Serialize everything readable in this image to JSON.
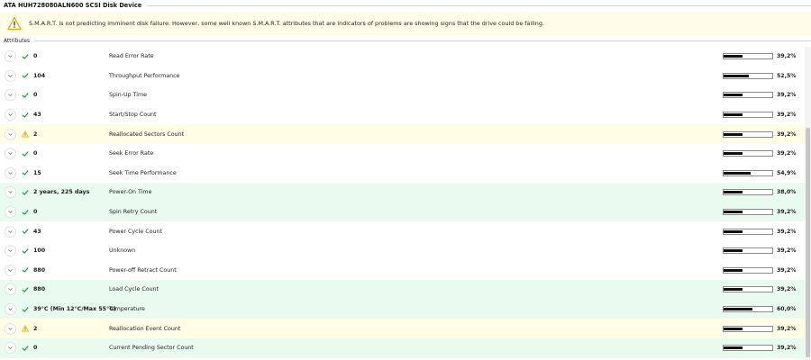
{
  "device": {
    "title": "ATA HUH728080ALN600 SCSI Disk Device"
  },
  "warning": {
    "text": "S.M.A.R.T. is not predicting imminent disk failure. However, some well known S.M.A.R.T. attributes that are indicators of problems are showing signs that the drive could be failing.",
    "icon": "warning-triangle-icon"
  },
  "attributes": {
    "title": "Attributes",
    "rows": [
      {
        "status": "ok",
        "value": "0",
        "name": "Read Error Rate",
        "percent": "39,2%",
        "fill": 0.392,
        "highlight": "none"
      },
      {
        "status": "ok",
        "value": "104",
        "name": "Throughput Performance",
        "percent": "52,5%",
        "fill": 0.525,
        "highlight": "none"
      },
      {
        "status": "ok",
        "value": "0",
        "name": "Spin-Up Time",
        "percent": "39,2%",
        "fill": 0.392,
        "highlight": "none"
      },
      {
        "status": "ok",
        "value": "43",
        "name": "Start/Stop Count",
        "percent": "39,2%",
        "fill": 0.392,
        "highlight": "none"
      },
      {
        "status": "warning",
        "value": "2",
        "name": "Reallocated Sectors Count",
        "percent": "39,2%",
        "fill": 0.392,
        "highlight": "yellow"
      },
      {
        "status": "ok",
        "value": "0",
        "name": "Seek Error Rate",
        "percent": "39,2%",
        "fill": 0.392,
        "highlight": "none"
      },
      {
        "status": "ok",
        "value": "15",
        "name": "Seek Time Performance",
        "percent": "54,9%",
        "fill": 0.549,
        "highlight": "none"
      },
      {
        "status": "ok",
        "value": "2 years, 225 days",
        "name": "Power-On Time",
        "percent": "38,0%",
        "fill": 0.38,
        "highlight": "green"
      },
      {
        "status": "ok",
        "value": "0",
        "name": "Spin Retry Count",
        "percent": "39,2%",
        "fill": 0.392,
        "highlight": "green"
      },
      {
        "status": "ok",
        "value": "43",
        "name": "Power Cycle Count",
        "percent": "39,2%",
        "fill": 0.392,
        "highlight": "none"
      },
      {
        "status": "ok",
        "value": "100",
        "name": "Unknown",
        "percent": "39,2%",
        "fill": 0.392,
        "highlight": "none"
      },
      {
        "status": "ok",
        "value": "880",
        "name": "Power-off Retract Count",
        "percent": "39,2%",
        "fill": 0.392,
        "highlight": "none"
      },
      {
        "status": "ok",
        "value": "880",
        "name": "Load Cycle Count",
        "percent": "39,2%",
        "fill": 0.392,
        "highlight": "green"
      },
      {
        "status": "ok",
        "value": "39°C (Min 12°C/Max 55°C)",
        "name": "Temperature",
        "percent": "60,0%",
        "fill": 0.6,
        "highlight": "green"
      },
      {
        "status": "warning",
        "value": "2",
        "name": "Reallocation Event Count",
        "percent": "39,2%",
        "fill": 0.392,
        "highlight": "yellow"
      },
      {
        "status": "ok",
        "value": "0",
        "name": "Current Pending Sector Count",
        "percent": "39,2%",
        "fill": 0.392,
        "highlight": "green"
      }
    ]
  },
  "colors": {
    "ok_check": "#22a04a",
    "warning": "#e0a800",
    "row_yellow": "#fffde6",
    "row_green": "#e9fbef",
    "bar_fill": "#111111"
  }
}
